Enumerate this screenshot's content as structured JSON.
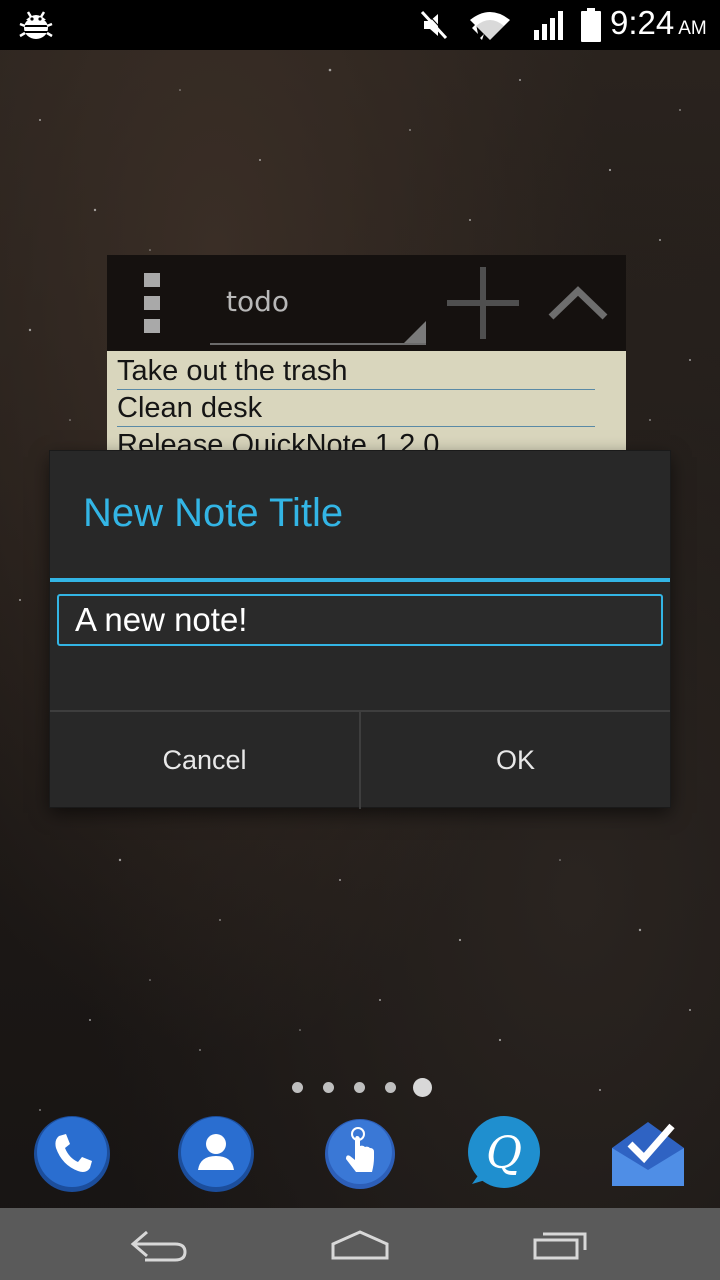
{
  "status_bar": {
    "time": "9:24",
    "ampm": "AM",
    "icons": [
      "debug-bug-icon",
      "volume-muted-icon",
      "wifi-icon",
      "cell-signal-icon",
      "battery-icon"
    ]
  },
  "widget": {
    "list_selector": "todo",
    "notes": [
      "Take out the trash",
      "Clean desk",
      "Release QuickNote 1.2.0"
    ],
    "icons": [
      "overflow-menu-icon",
      "add-icon",
      "collapse-icon"
    ]
  },
  "dialog": {
    "title": "New Note Title",
    "input_value": "A new note!",
    "cancel_label": "Cancel",
    "ok_label": "OK"
  },
  "home": {
    "page_count": 5,
    "active_page": 5,
    "dock": [
      "phone-icon",
      "contacts-icon",
      "tap-gesture-icon",
      "quicknote-icon",
      "inbox-icon"
    ]
  },
  "nav_bar": {
    "buttons": [
      "back-icon",
      "home-icon",
      "recents-icon"
    ]
  },
  "colors": {
    "accent": "#33b5e5",
    "dialog_bg": "#282828",
    "widget_body": "#d9d6bd",
    "nav_bar": "#5a5a5a"
  }
}
